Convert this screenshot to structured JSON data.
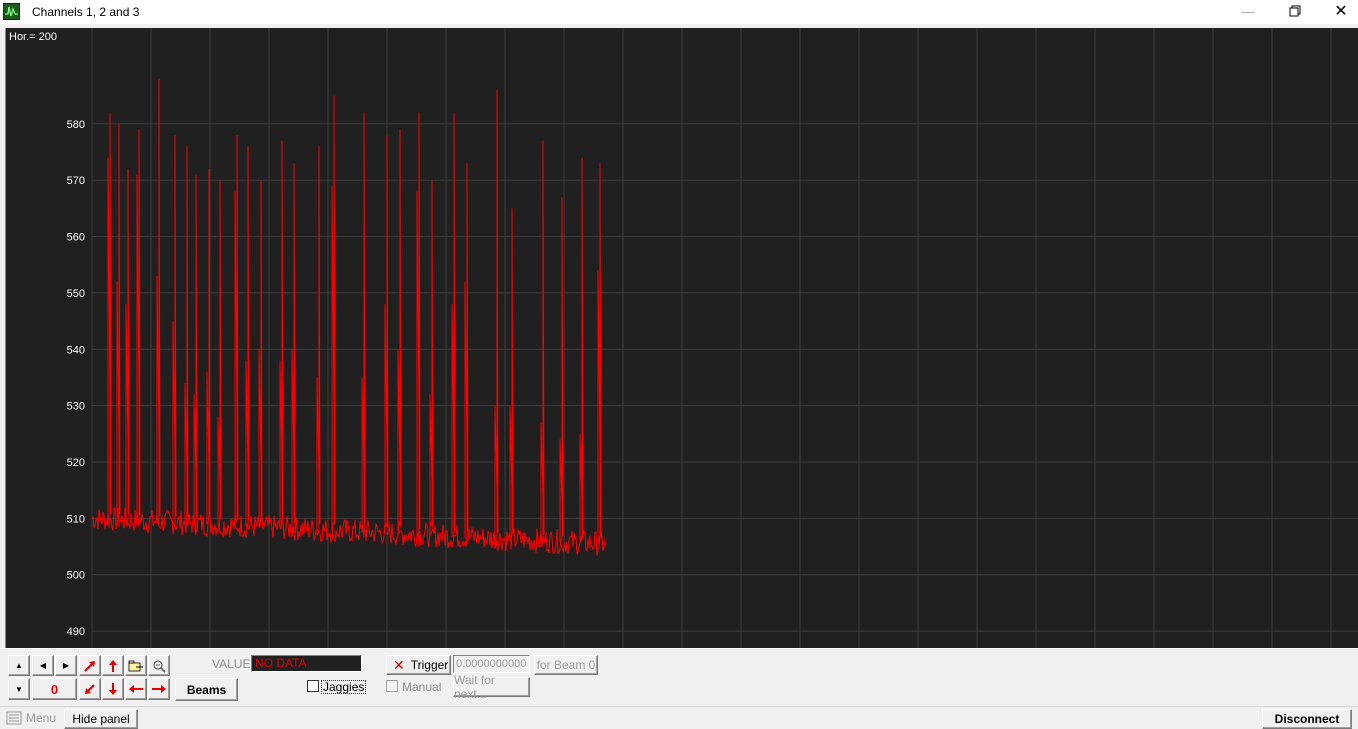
{
  "window": {
    "title": "Channels 1, 2 and 3"
  },
  "scope": {
    "hor_label": "Hor.= 200",
    "background": "#202020",
    "grid_color": "#3c3c3c",
    "trace_color": "#ff0000"
  },
  "chart_data": {
    "type": "line",
    "title": "",
    "xlabel": "",
    "ylabel": "",
    "yticks": [
      "580",
      "570",
      "560",
      "550",
      "540",
      "530",
      "520",
      "510",
      "500",
      "490"
    ],
    "ylim": [
      487,
      597
    ],
    "grid": true,
    "series": [
      {
        "color": "#ff0000",
        "spikes": [
          {
            "i": 0.035,
            "peak": 582,
            "sub": 574
          },
          {
            "i": 0.052,
            "peak": 580,
            "sub": 552
          },
          {
            "i": 0.07,
            "peak": 572,
            "sub": 548
          },
          {
            "i": 0.092,
            "peak": 579,
            "sub": 571
          },
          {
            "i": 0.131,
            "peak": 588,
            "sub": 553
          },
          {
            "i": 0.161,
            "peak": 578,
            "sub": 545
          },
          {
            "i": 0.185,
            "peak": 576,
            "sub": 534
          },
          {
            "i": 0.203,
            "peak": 571,
            "sub": 532
          },
          {
            "i": 0.228,
            "peak": 572,
            "sub": 536
          },
          {
            "i": 0.25,
            "peak": 570,
            "sub": 528
          },
          {
            "i": 0.283,
            "peak": 578,
            "sub": 568
          },
          {
            "i": 0.304,
            "peak": 576,
            "sub": 538
          },
          {
            "i": 0.33,
            "peak": 570,
            "sub": 540
          },
          {
            "i": 0.37,
            "peak": 577,
            "sub": 538
          },
          {
            "i": 0.394,
            "peak": 573,
            "sub": 540
          },
          {
            "i": 0.442,
            "peak": 576,
            "sub": 535
          },
          {
            "i": 0.472,
            "peak": 585,
            "sub": 569
          },
          {
            "i": 0.53,
            "peak": 582,
            "sub": 535
          },
          {
            "i": 0.575,
            "peak": 578,
            "sub": 548
          },
          {
            "i": 0.6,
            "peak": 579,
            "sub": 540
          },
          {
            "i": 0.637,
            "peak": 582,
            "sub": 568
          },
          {
            "i": 0.662,
            "peak": 570,
            "sub": 532
          },
          {
            "i": 0.705,
            "peak": 582,
            "sub": 548
          },
          {
            "i": 0.73,
            "peak": 573,
            "sub": 552
          },
          {
            "i": 0.79,
            "peak": 586,
            "sub": 530
          },
          {
            "i": 0.819,
            "peak": 565,
            "sub": 530
          },
          {
            "i": 0.878,
            "peak": 577,
            "sub": 527
          },
          {
            "i": 0.915,
            "peak": 567,
            "sub": 524
          },
          {
            "i": 0.955,
            "peak": 574,
            "sub": 525
          },
          {
            "i": 0.99,
            "peak": 573,
            "sub": 554
          }
        ],
        "baseline": {
          "start": 510,
          "end": 505.5,
          "noise": 2.2
        },
        "x_fraction_end": 0.405
      }
    ]
  },
  "controls": {
    "value_label": "VALUE:",
    "value_text": "NO DATA",
    "offset_value": "0",
    "beams_label": "Beams",
    "trigger_label": "Trigger",
    "trigger_value": "0.0000000000",
    "for_beam_label": "for Beam 0",
    "manual_label": "Manual",
    "wait_label": "Wait for next...",
    "jaggies_label": "Jaggies"
  },
  "statusbar": {
    "menu_label": "Menu",
    "hide_panel_label": "Hide panel",
    "disconnect_label": "Disconnect"
  }
}
